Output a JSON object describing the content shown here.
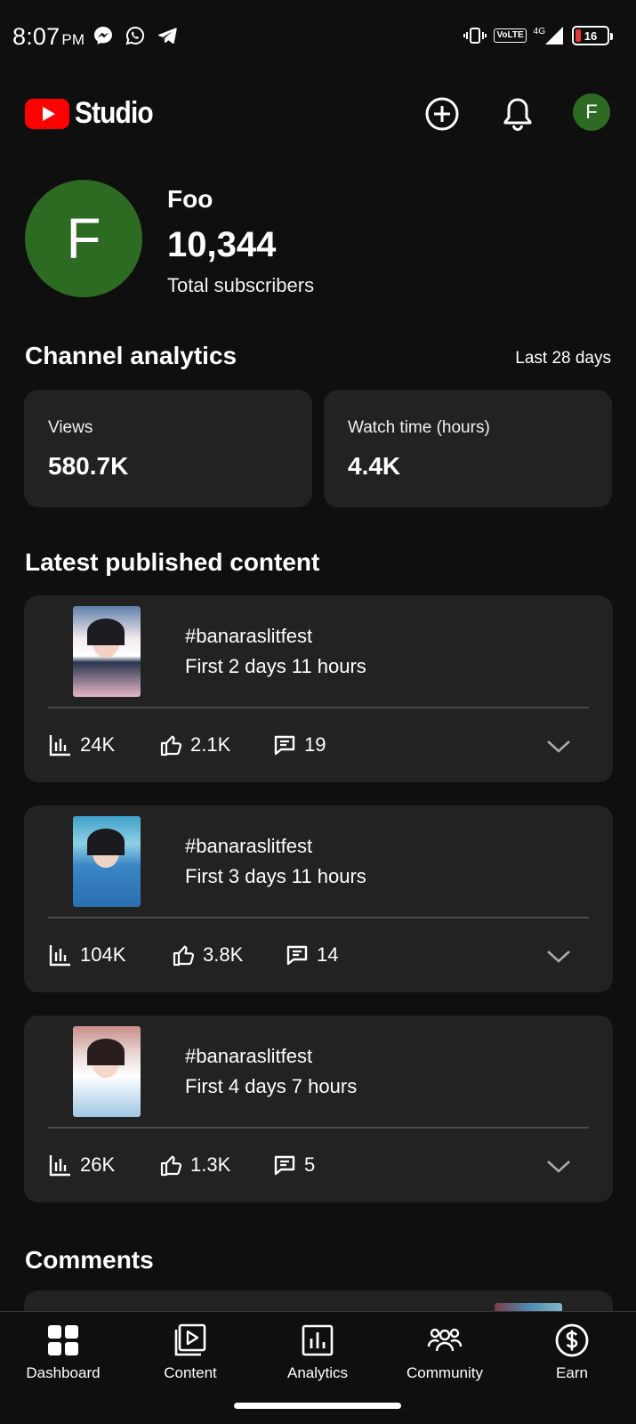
{
  "status_bar": {
    "time": "8:07",
    "ampm": "PM",
    "network_label": "VoLTE",
    "network_type": "4G",
    "battery_level": "16",
    "icons": [
      "messenger-icon",
      "whatsapp-icon",
      "telegram-icon",
      "vibrate-icon",
      "signal-icon",
      "battery-icon"
    ]
  },
  "header": {
    "logo_text": "Studio",
    "avatar_letter": "F"
  },
  "channel": {
    "avatar_letter": "F",
    "name": "Foo",
    "subscribers": "10,344",
    "subscribers_label": "Total subscribers"
  },
  "analytics": {
    "title": "Channel analytics",
    "period": "Last 28 days",
    "metrics": [
      {
        "label": "Views",
        "value": "580.7K"
      },
      {
        "label": "Watch time (hours)",
        "value": "4.4K"
      }
    ]
  },
  "latest": {
    "title": "Latest published content",
    "videos": [
      {
        "title": "#banaraslitfest",
        "period": "First 2 days 11 hours",
        "views": "24K",
        "likes": "2.1K",
        "comments": "19"
      },
      {
        "title": "#banaraslitfest",
        "period": "First 3 days 11 hours",
        "views": "104K",
        "likes": "3.8K",
        "comments": "14"
      },
      {
        "title": "#banaraslitfest",
        "period": "First 4 days 7 hours",
        "views": "26K",
        "likes": "1.3K",
        "comments": "5"
      }
    ]
  },
  "comments": {
    "title": "Comments"
  },
  "nav": {
    "items": [
      {
        "label": "Dashboard",
        "icon": "dashboard-icon"
      },
      {
        "label": "Content",
        "icon": "content-icon"
      },
      {
        "label": "Analytics",
        "icon": "analytics-icon"
      },
      {
        "label": "Community",
        "icon": "community-icon"
      },
      {
        "label": "Earn",
        "icon": "earn-icon"
      }
    ]
  },
  "colors": {
    "background": "#0f0f0f",
    "card": "#222222",
    "brand_red": "#ff0000",
    "avatar_green": "#2e6b22"
  }
}
